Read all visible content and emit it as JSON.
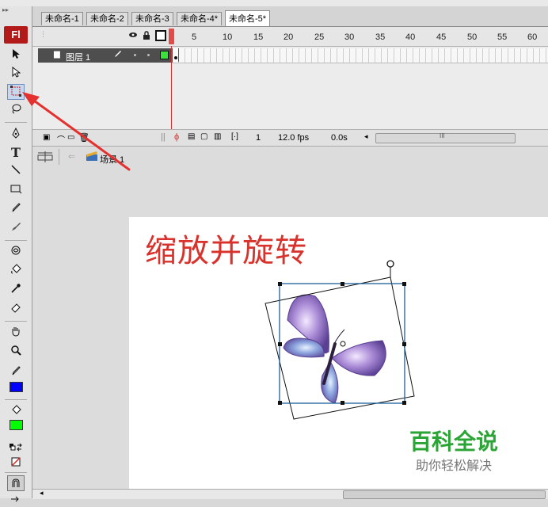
{
  "document_tabs": [
    "未命名-1",
    "未命名-2",
    "未命名-3",
    "未命名-4*",
    "未命名-5*"
  ],
  "active_tab_index": 4,
  "toolbar": {
    "logo": "Fl",
    "text_tool_label": "T",
    "stroke_color": "#0000ff",
    "fill_color": "#00ff00"
  },
  "timeline": {
    "frame_numbers": [
      "5",
      "10",
      "15",
      "20",
      "25",
      "30",
      "35",
      "40",
      "45",
      "50",
      "55",
      "60"
    ],
    "layer_name": "图层 1",
    "current_frame": "1",
    "fps": "12.0 fps",
    "elapsed": "0.0s",
    "scroll_grip": "III"
  },
  "editbar": {
    "scene_label": "场景 1"
  },
  "stage": {
    "title": "缩放并旋转",
    "brand_main": "百科全说",
    "brand_sub": "助你轻松解决"
  },
  "colors": {
    "title_red": "#d9312b",
    "brand_green": "#2aa535",
    "arrow_red": "#e53030"
  }
}
